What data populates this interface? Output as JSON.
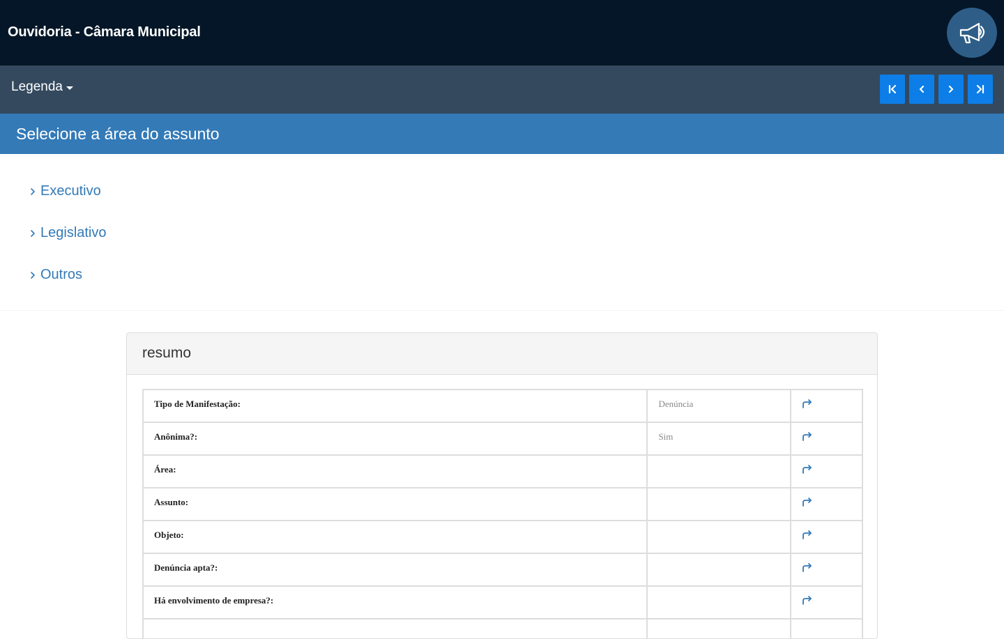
{
  "header": {
    "title": "Ouvidoria - Câmara Municipal",
    "megaphone_icon": "megaphone-icon"
  },
  "toolbar": {
    "legenda_label": "Legenda",
    "nav_buttons": [
      {
        "name": "first-page-button",
        "icon": "skip-first-icon"
      },
      {
        "name": "previous-page-button",
        "icon": "chevron-left-icon"
      },
      {
        "name": "next-page-button",
        "icon": "chevron-right-icon"
      },
      {
        "name": "last-page-button",
        "icon": "skip-last-icon"
      }
    ]
  },
  "section": {
    "heading": "Selecione a área do assunto",
    "areas": [
      {
        "label": "Executivo"
      },
      {
        "label": "Legislativo"
      },
      {
        "label": "Outros"
      }
    ]
  },
  "summary": {
    "title": "resumo",
    "rows": [
      {
        "label": "Tipo de Manifestação:",
        "value": "Denúncia"
      },
      {
        "label": "Anônima?:",
        "value": "Sim"
      },
      {
        "label": "Área:",
        "value": ""
      },
      {
        "label": "Assunto:",
        "value": ""
      },
      {
        "label": "Objeto:",
        "value": ""
      },
      {
        "label": "Denúncia apta?:",
        "value": ""
      },
      {
        "label": "Há envolvimento de empresa?:",
        "value": ""
      },
      {
        "label": "",
        "value": ""
      }
    ],
    "edit_icon": "share-arrow-icon"
  },
  "colors": {
    "header_bg": "#041627",
    "toolbar_bg": "#34495e",
    "section_bg": "#337ab7",
    "nav_button": "#0d7ee8",
    "link": "#337ab7"
  }
}
